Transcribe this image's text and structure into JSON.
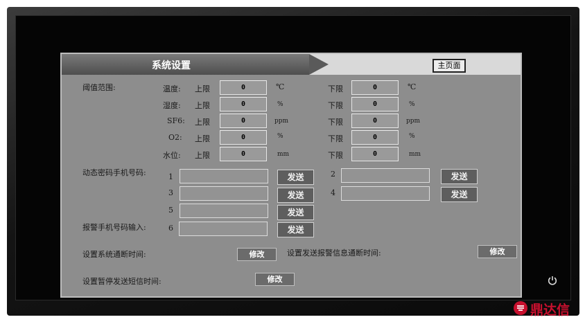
{
  "header": {
    "title": "系统设置",
    "home_button": "主页面"
  },
  "threshold": {
    "section_label": "阈值范围:",
    "upper_label": "上限",
    "lower_label": "下限",
    "rows": [
      {
        "name": "温度:",
        "upper": "0",
        "upper_unit": "℃",
        "lower": "0",
        "lower_unit": "℃"
      },
      {
        "name": "湿度:",
        "upper": "0",
        "upper_unit": "%",
        "lower": "0",
        "lower_unit": "%"
      },
      {
        "name": "SF6:",
        "upper": "0",
        "upper_unit": "ppm",
        "lower": "0",
        "lower_unit": "ppm"
      },
      {
        "name": "O2:",
        "upper": "0",
        "upper_unit": "%",
        "lower": "0",
        "lower_unit": "%"
      },
      {
        "name": "水位:",
        "upper": "0",
        "upper_unit": "mm",
        "lower": "0",
        "lower_unit": "mm"
      }
    ]
  },
  "phones": {
    "dynamic_label": "动态密码手机号码:",
    "alarm_label": "报警手机号码输入:",
    "send_label": "发送",
    "slots": [
      {
        "index": "1",
        "value": ""
      },
      {
        "index": "2",
        "value": ""
      },
      {
        "index": "3",
        "value": ""
      },
      {
        "index": "4",
        "value": ""
      },
      {
        "index": "5",
        "value": ""
      },
      {
        "index": "6",
        "value": ""
      }
    ]
  },
  "settings": {
    "comm_break_label": "设置系统通断时间:",
    "alarm_info_label": "设置发送报警信息通断时间:",
    "pause_sms_label": "设置暂停发送短信时间:",
    "modify_label": "修改"
  },
  "brand": {
    "logo_text": "鼎达信"
  },
  "colors": {
    "panel": "#8d8d8d",
    "header": "#5a5a5a",
    "brand": "#c8102e"
  }
}
